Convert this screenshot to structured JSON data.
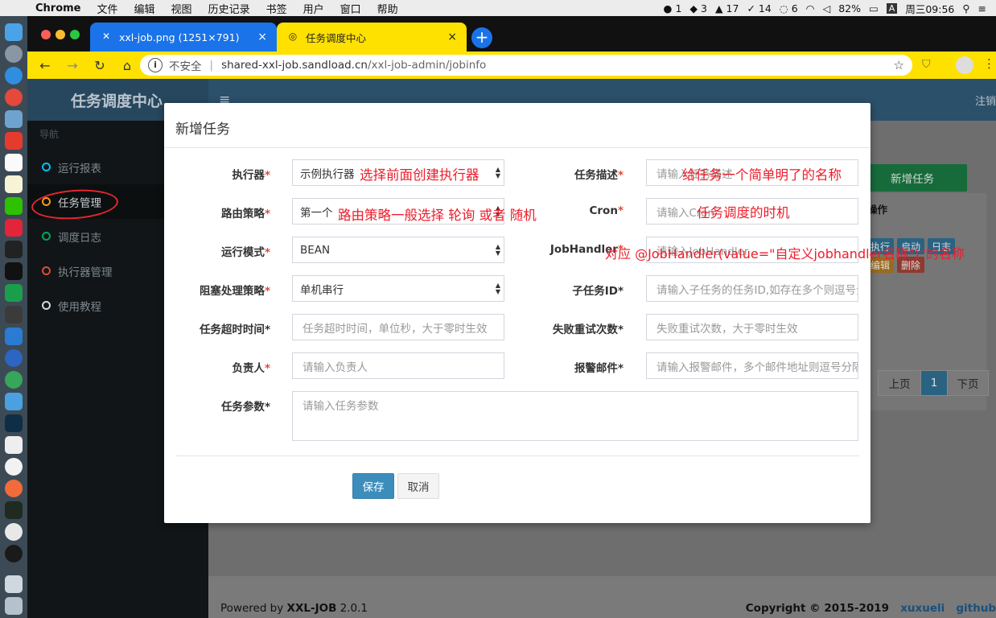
{
  "menubar": {
    "app": "Chrome",
    "items": [
      "文件",
      "编辑",
      "视图",
      "历史记录",
      "书签",
      "用户",
      "窗口",
      "帮助"
    ],
    "status": {
      "wechat": "1",
      "g_badge": "3",
      "bell": "17",
      "check": "14",
      "chat": "6",
      "battery": "82%",
      "input": "A",
      "clock": "周三09:56"
    }
  },
  "browser": {
    "tabs": [
      {
        "label": "xxl-job.png (1251×791)",
        "close": "×"
      },
      {
        "label": "任务调度中心",
        "close": "×"
      }
    ],
    "new_tab": "+",
    "security": "不安全",
    "url_host": "shared-xxl-job.sandload.cn",
    "url_path": "/xxl-job-admin/jobinfo"
  },
  "app": {
    "logo": "任务调度中心",
    "logout": "注销",
    "nav_header": "导航",
    "nav": [
      {
        "label": "运行报表",
        "color": "#00c0ef"
      },
      {
        "label": "任务管理",
        "color": "#f39c12"
      },
      {
        "label": "调度日志",
        "color": "#00a65a"
      },
      {
        "label": "执行器管理",
        "color": "#dd4b39"
      },
      {
        "label": "使用教程",
        "color": "#d2d6de"
      }
    ],
    "add_button": "新增任务",
    "op_header": "操作",
    "ops": [
      "执行",
      "启动",
      "日志",
      "编辑",
      "删除"
    ],
    "pager": {
      "prev": "上页",
      "current": "1",
      "next": "下页"
    },
    "footer_left_prefix": "Powered by ",
    "footer_left_brand": "XXL-JOB",
    "footer_left_version": " 2.0.1",
    "footer_right": "Copyright © 2015-2019",
    "footer_author": "xuxueli",
    "footer_github": "github"
  },
  "modal": {
    "title": "新增任务",
    "fields": {
      "executor": {
        "label": "执行器",
        "value": "示例执行器"
      },
      "desc": {
        "label": "任务描述",
        "placeholder": "请输入任务描述"
      },
      "route": {
        "label": "路由策略",
        "value": "第一个"
      },
      "cron": {
        "label": "Cron",
        "placeholder": "请输入Cron"
      },
      "mode": {
        "label": "运行模式",
        "value": "BEAN"
      },
      "jobhandler": {
        "label": "JobHandler",
        "placeholder": "请输入JobHandler"
      },
      "block": {
        "label": "阻塞处理策略",
        "value": "单机串行"
      },
      "child": {
        "label": "子任务ID",
        "placeholder": "请输入子任务的任务ID,如存在多个则逗号分隔"
      },
      "timeout": {
        "label": "任务超时时间",
        "placeholder": "任务超时时间，单位秒，大于零时生效"
      },
      "retry": {
        "label": "失败重试次数",
        "placeholder": "失败重试次数，大于零时生效"
      },
      "owner": {
        "label": "负责人",
        "placeholder": "请输入负责人"
      },
      "alarm": {
        "label": "报警邮件",
        "placeholder": "请输入报警邮件，多个邮件地址则逗号分隔"
      },
      "param": {
        "label": "任务参数",
        "placeholder": "请输入任务参数"
      }
    },
    "save": "保存",
    "cancel": "取消"
  },
  "annotations": {
    "executor": "选择前面创建执行器",
    "route": "路由策略一般选择 轮询 或者 随机",
    "desc": "给任务一个简单明了的名称",
    "cron": "任务调度的时机",
    "jobhandler": "对应 @JobHandler(value=\"自定义jobhandler名称\")”的名称"
  }
}
